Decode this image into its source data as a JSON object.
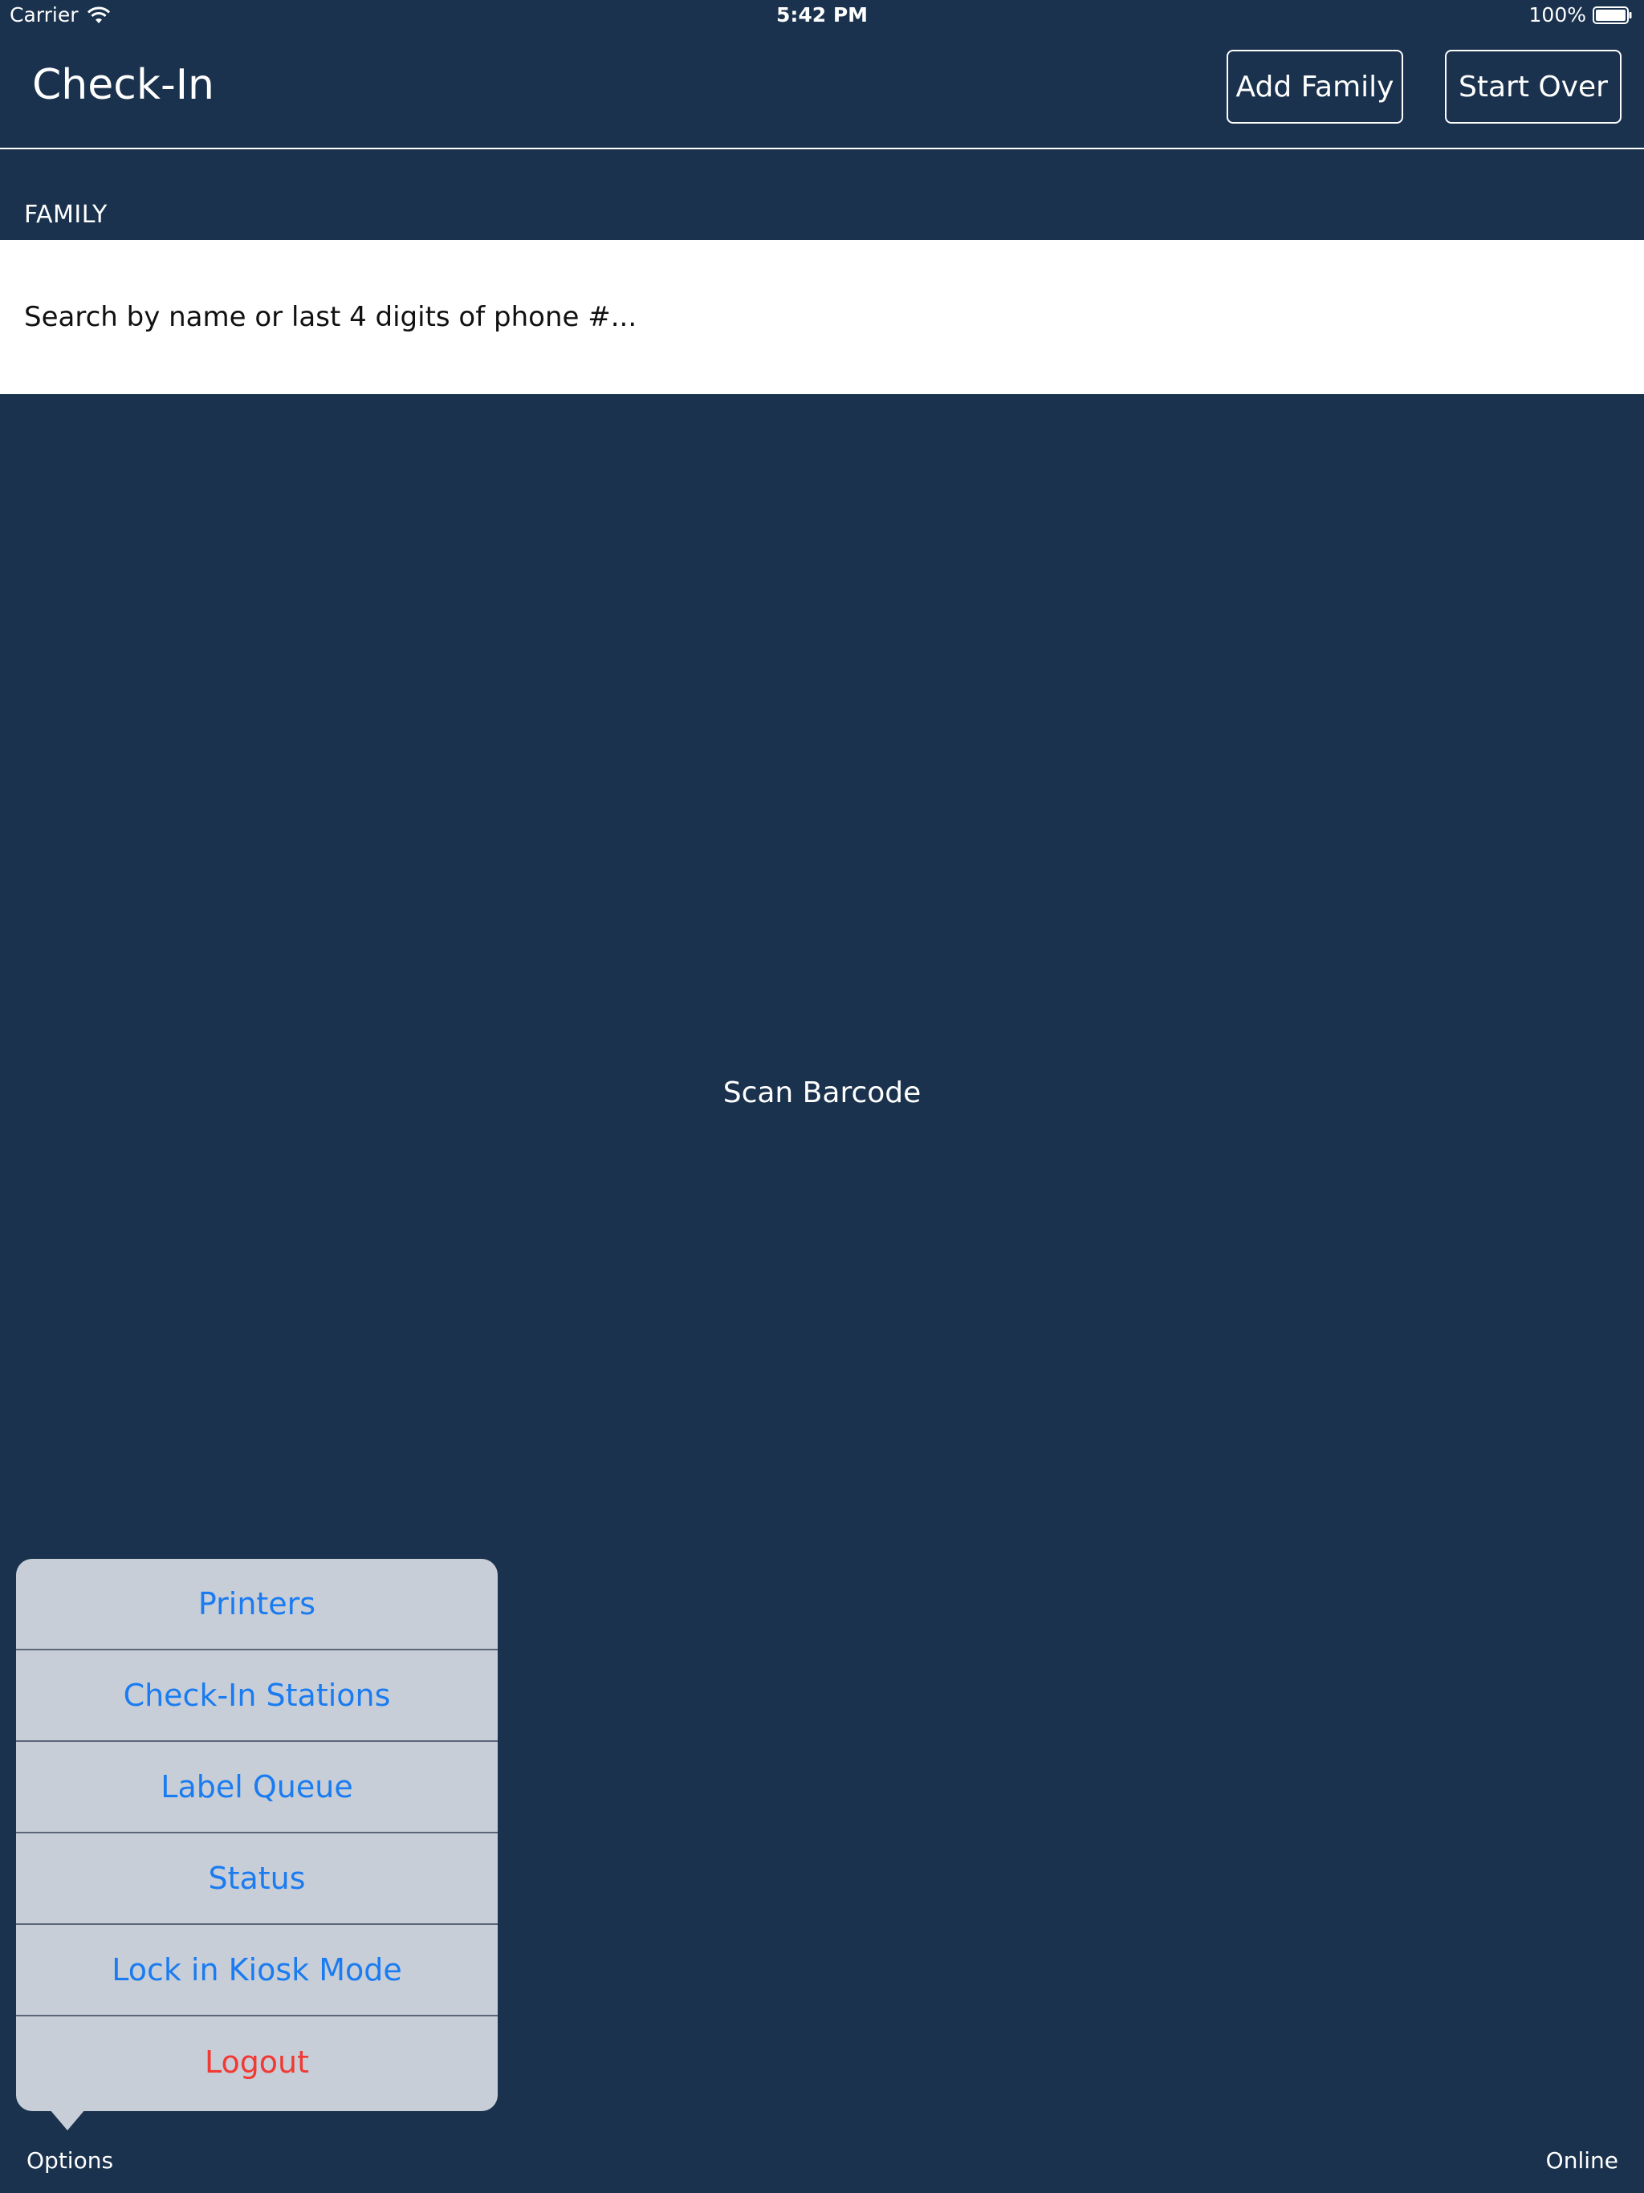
{
  "status_bar": {
    "carrier": "Carrier",
    "time": "5:42 PM",
    "battery": "100%"
  },
  "header": {
    "title": "Check-In",
    "add_family_label": "Add Family",
    "start_over_label": "Start Over"
  },
  "family": {
    "section_label": "FAMILY",
    "search_placeholder": "Search by name or last 4 digits of phone #..."
  },
  "scan": {
    "label": "Scan Barcode"
  },
  "options_menu": {
    "items": [
      {
        "label": "Printers"
      },
      {
        "label": "Check-In Stations"
      },
      {
        "label": "Label Queue"
      },
      {
        "label": "Status"
      },
      {
        "label": "Lock in Kiosk Mode"
      },
      {
        "label": "Logout"
      }
    ]
  },
  "footer": {
    "options_label": "Options",
    "connection_status": "Online"
  },
  "colors": {
    "background": "#1a324d",
    "menu_background": "#c8ced8",
    "menu_link": "#1a7cf0",
    "destructive": "#f03a33"
  }
}
